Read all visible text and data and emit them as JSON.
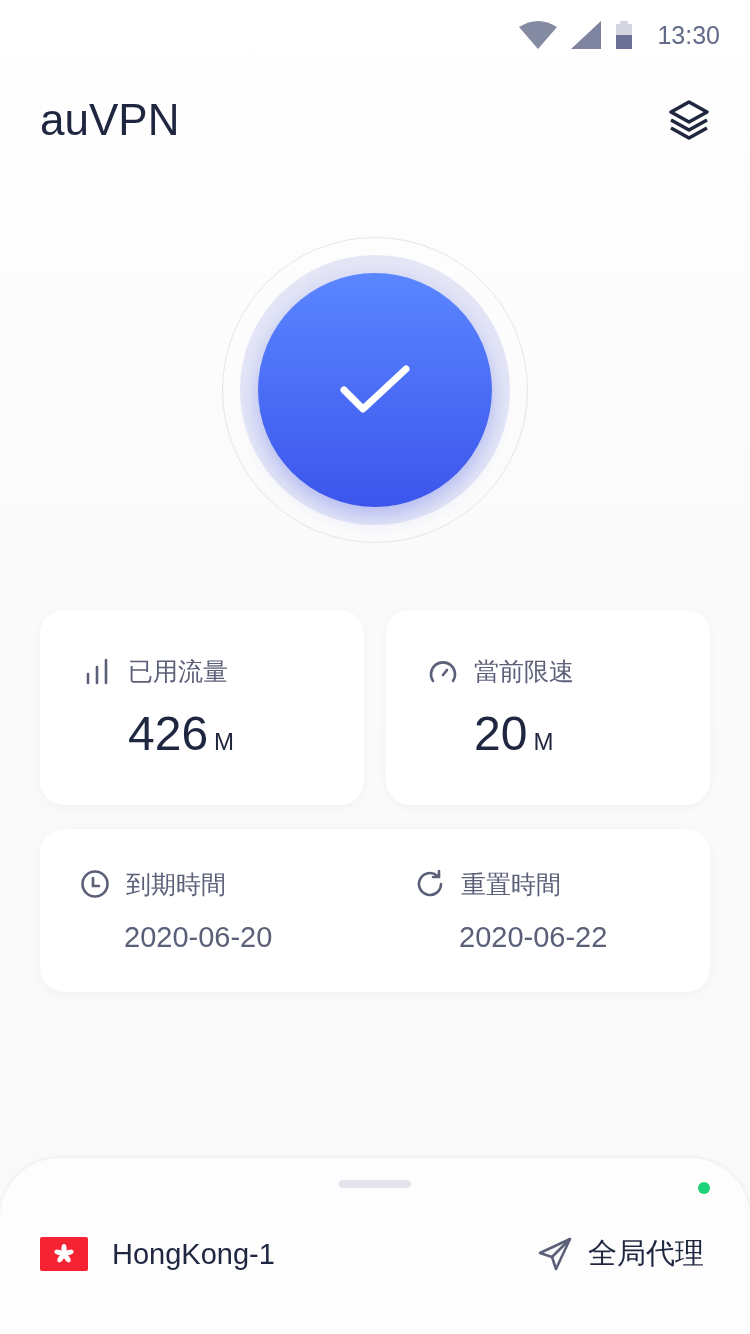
{
  "status_bar": {
    "time": "13:30"
  },
  "header": {
    "title": "auVPN"
  },
  "connect_button": {
    "connected": true
  },
  "stats": [
    {
      "kind": "traffic",
      "label": "已用流量",
      "value": "426",
      "unit": "M"
    },
    {
      "kind": "speed",
      "label": "當前限速",
      "value": "20",
      "unit": "M"
    }
  ],
  "dates": [
    {
      "kind": "expiry",
      "label": "到期時間",
      "value": "2020-06-20"
    },
    {
      "kind": "reset",
      "label": "重置時間",
      "value": "2020-06-22"
    }
  ],
  "bottom_sheet": {
    "online": true,
    "server": "HongKong-1",
    "mode": "全局代理"
  }
}
